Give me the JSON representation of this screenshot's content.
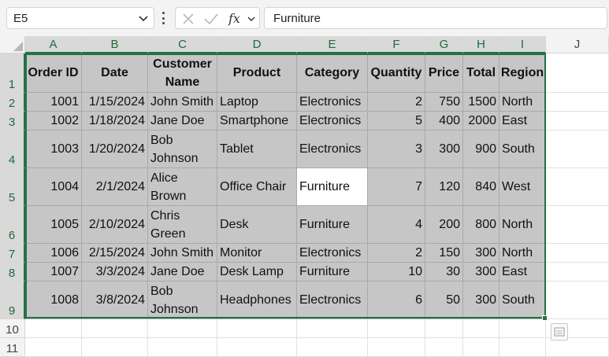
{
  "formula_bar": {
    "name_box": "E5",
    "formula": "Furniture"
  },
  "columns": [
    "A",
    "B",
    "C",
    "D",
    "E",
    "F",
    "G",
    "H",
    "I",
    "J"
  ],
  "rows": [
    "1",
    "2",
    "3",
    "4",
    "5",
    "6",
    "7",
    "8",
    "9",
    "10",
    "11"
  ],
  "table": {
    "headers": [
      "Order ID",
      "Date",
      "Customer Name",
      "Product",
      "Category",
      "Quantity",
      "Price",
      "Total",
      "Region"
    ],
    "records": [
      [
        "1001",
        "1/15/2024",
        "John Smith",
        "Laptop",
        "Electronics",
        "2",
        "750",
        "1500",
        "North"
      ],
      [
        "1002",
        "1/18/2024",
        "Jane Doe",
        "Smartphone",
        "Electronics",
        "5",
        "400",
        "2000",
        "East"
      ],
      [
        "1003",
        "1/20/2024",
        "Bob Johnson",
        "Tablet",
        "Electronics",
        "3",
        "300",
        "900",
        "South"
      ],
      [
        "1004",
        "2/1/2024",
        "Alice Brown",
        "Office Chair",
        "Furniture",
        "7",
        "120",
        "840",
        "West"
      ],
      [
        "1005",
        "2/10/2024",
        "Chris Green",
        "Desk",
        "Furniture",
        "4",
        "200",
        "800",
        "North"
      ],
      [
        "1006",
        "2/15/2024",
        "John Smith",
        "Monitor",
        "Electronics",
        "2",
        "150",
        "300",
        "North"
      ],
      [
        "1007",
        "3/3/2024",
        "Jane Doe",
        "Desk Lamp",
        "Furniture",
        "10",
        "30",
        "300",
        "East"
      ],
      [
        "1008",
        "3/8/2024",
        "Bob Johnson",
        "Headphones",
        "Electronics",
        "6",
        "50",
        "300",
        "South"
      ]
    ]
  },
  "selection": {
    "range_columns": "A:I",
    "range_rows": "1:9",
    "active_cell": "E5"
  },
  "colors": {
    "accent": "#217346",
    "selection_fill": "#c6c6c6",
    "header_fill": "#f3f3f3"
  },
  "icons": [
    "chevron-down-icon",
    "more-options-icon",
    "cancel-icon",
    "enter-icon",
    "insert-function-icon",
    "quick-analysis-icon"
  ]
}
